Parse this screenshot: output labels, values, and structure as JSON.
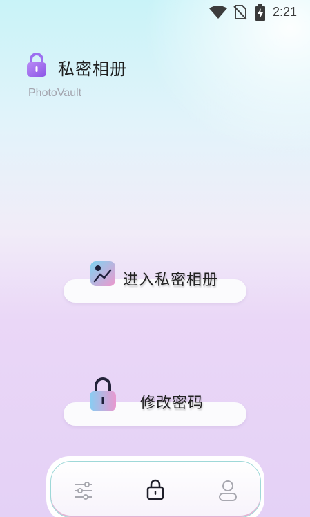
{
  "status_bar": {
    "time": "2:21",
    "icons": [
      "wifi-icon",
      "no-sim-icon",
      "battery-charging-icon"
    ]
  },
  "header": {
    "title": "私密相册",
    "subtitle": "PhotoVault",
    "icon": "lock-icon"
  },
  "actions": [
    {
      "label": "进入私密相册",
      "icon": "gallery-icon"
    },
    {
      "label": "修改密码",
      "icon": "padlock-icon"
    }
  ],
  "bottom_nav": {
    "items": [
      {
        "icon": "settings-sliders-icon",
        "active": false
      },
      {
        "icon": "lock-icon",
        "active": true
      },
      {
        "icon": "profile-icon",
        "active": false
      }
    ]
  },
  "colors": {
    "accent_purple": "#a46cf0",
    "gradient_blue": "#8ad0f0",
    "gradient_pink": "#e79ad0"
  }
}
